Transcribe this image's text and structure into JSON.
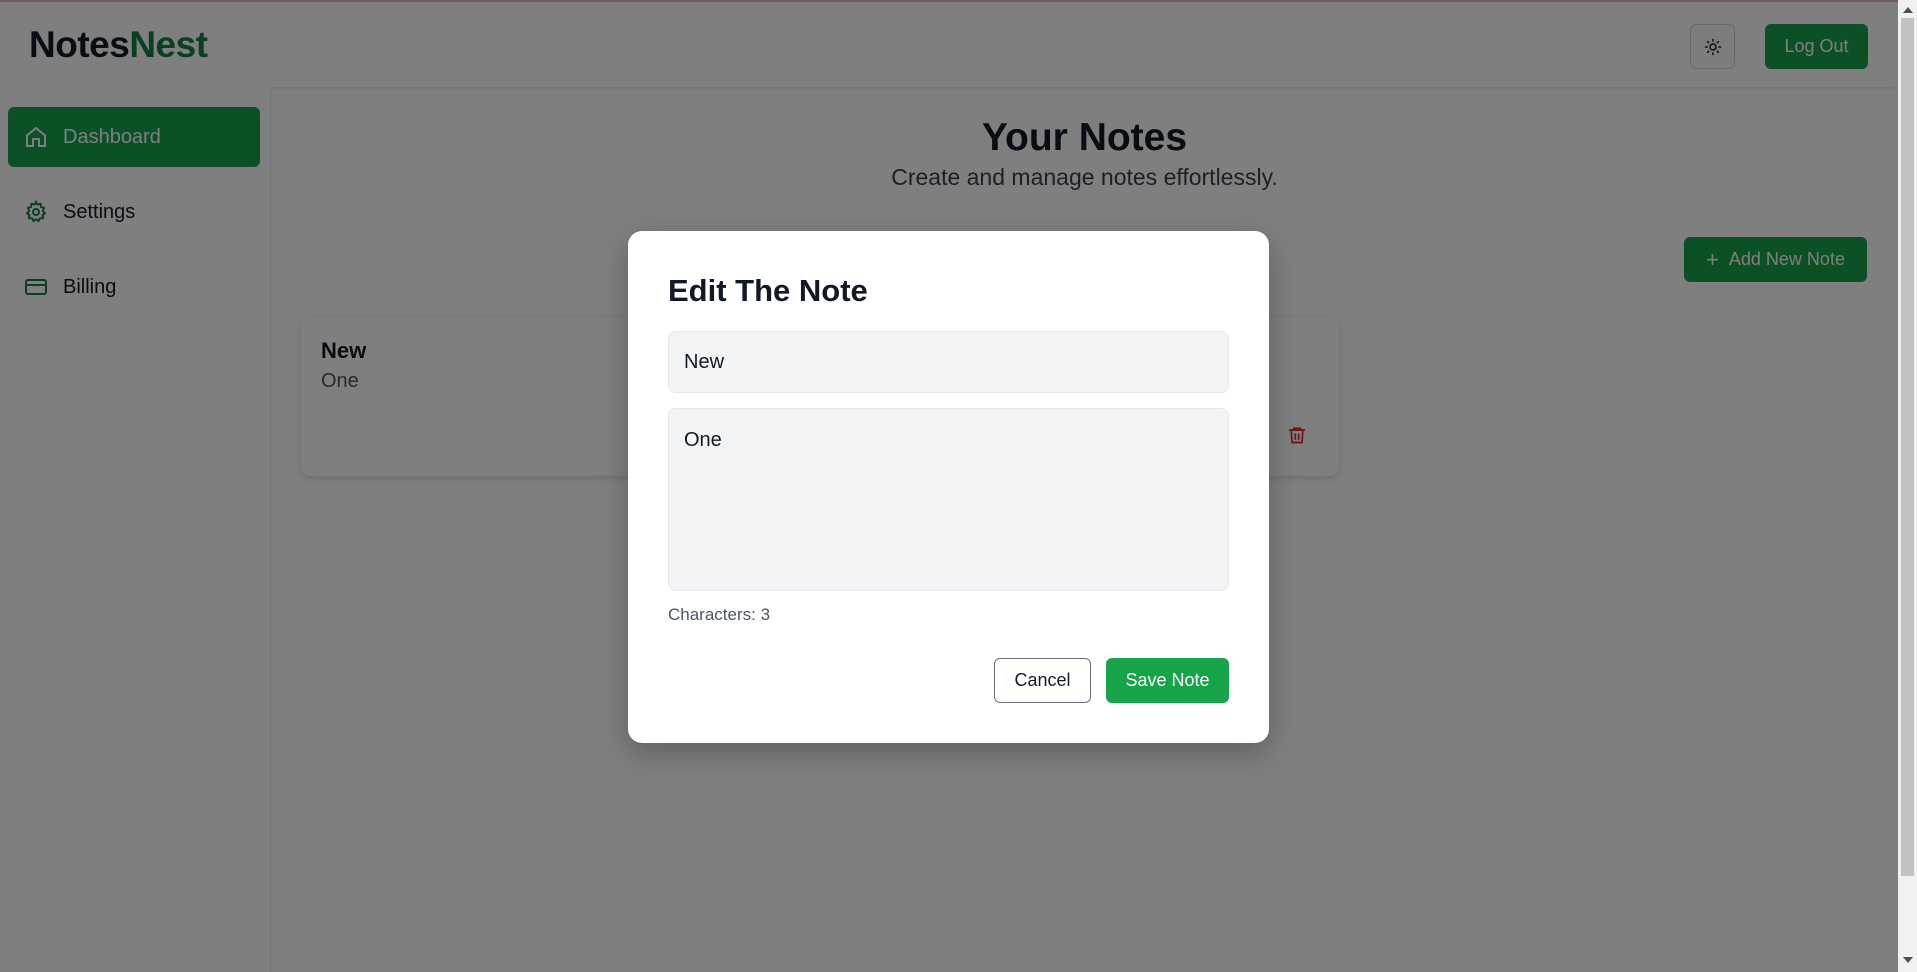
{
  "app": {
    "logo_part1": "Notes",
    "logo_part2": "Nest",
    "logout_label": "Log Out",
    "theme_icon": "sun-icon"
  },
  "sidebar": {
    "items": [
      {
        "label": "Dashboard",
        "icon": "home-icon",
        "active": true
      },
      {
        "label": "Settings",
        "icon": "gear-icon",
        "active": false
      },
      {
        "label": "Billing",
        "icon": "credit-card-icon",
        "active": false
      }
    ]
  },
  "main": {
    "title": "Your Notes",
    "subtitle": "Create and manage notes effortlessly.",
    "add_label": "Add New Note",
    "notes": [
      {
        "title": "New",
        "body": "One"
      }
    ]
  },
  "modal": {
    "title": "Edit The Note",
    "title_value": "New",
    "body_value": "One",
    "char_count_label": "Characters: 3",
    "cancel_label": "Cancel",
    "save_label": "Save Note"
  },
  "colors": {
    "accent": "#16a34a",
    "danger": "#dc2626",
    "overlay": "rgba(0,0,0,0.5)"
  }
}
